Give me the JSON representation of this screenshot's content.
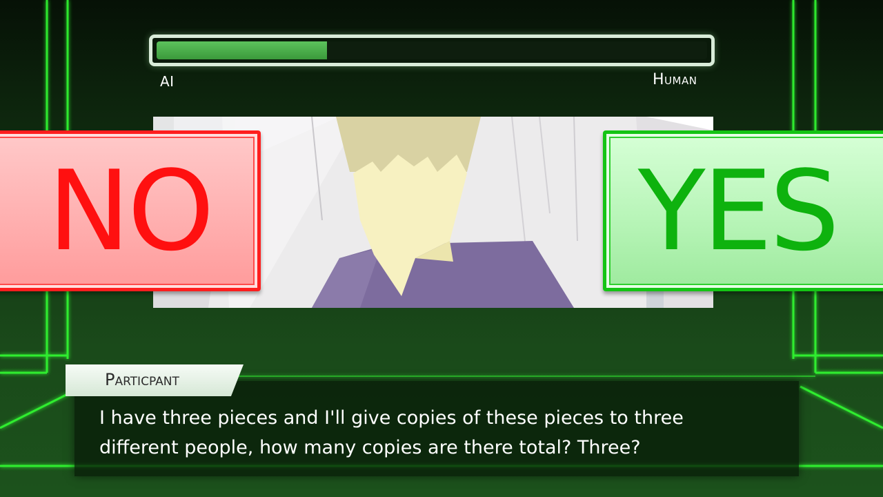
{
  "meter": {
    "left_label": "AI",
    "right_label": "Human",
    "fill_fraction": 0.31,
    "fill_color": "#4caf50"
  },
  "buttons": {
    "no_label": "NO",
    "yes_label": "YES",
    "no_color": "#ff1010",
    "yes_color": "#0eb20e"
  },
  "dialog": {
    "speaker": "Particpant",
    "text": "I have three pieces and I'll give copies of these pieces to three different people, how many copies are there total? Three?"
  },
  "colors": {
    "neon_accent": "#39ff39",
    "background": "#143814"
  }
}
